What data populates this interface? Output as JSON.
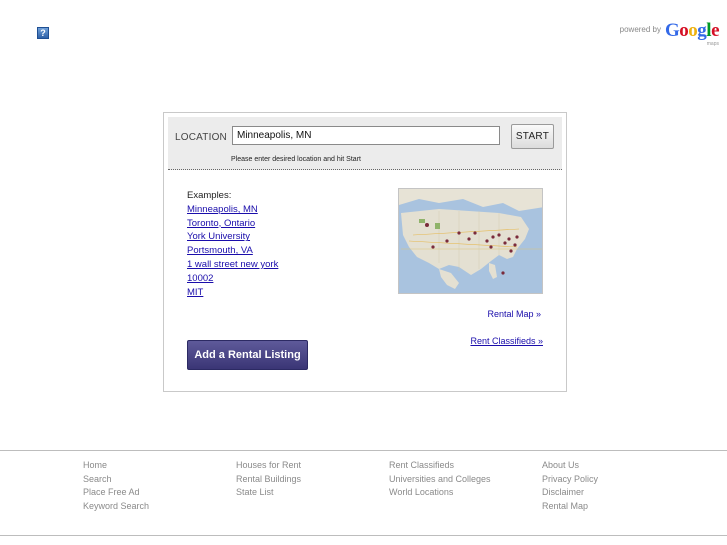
{
  "header": {
    "help_icon_glyph": "?",
    "powered_by": "powered by",
    "google_logo": "Google",
    "google_sub": "maps"
  },
  "location": {
    "label": "LOCATION",
    "input_value": "Minneapolis, MN",
    "start_label": "START",
    "hint": "Please enter desired location and hit Start"
  },
  "examples": {
    "title": "Examples:",
    "links": [
      "Minneapolis, MN",
      "Toronto, Ontario",
      "York University",
      "Portsmouth, VA",
      "1 wall street new york",
      "10002",
      "MIT"
    ]
  },
  "links": {
    "rental_map": "Rental Map »",
    "rent_classifieds": "Rent Classifieds »"
  },
  "add_listing_label": "Add a Rental Listing",
  "footer": {
    "columns": [
      [
        "Home",
        "Search",
        "Place Free Ad",
        "Keyword Search"
      ],
      [
        "Houses for Rent",
        "Rental Buildings",
        "State List"
      ],
      [
        "Rent Classifieds",
        "Universities and Colleges",
        "World Locations"
      ],
      [
        "About Us",
        "Privacy Policy",
        "Disclaimer",
        "Rental Map"
      ]
    ]
  },
  "colors": {
    "link": "#1a0dab",
    "button_purple": "#4a4586",
    "footer_text": "#8a8a8a",
    "google_blue": "#3369e8",
    "google_red": "#d50f25",
    "google_yellow": "#eeb211",
    "google_green": "#009925"
  }
}
